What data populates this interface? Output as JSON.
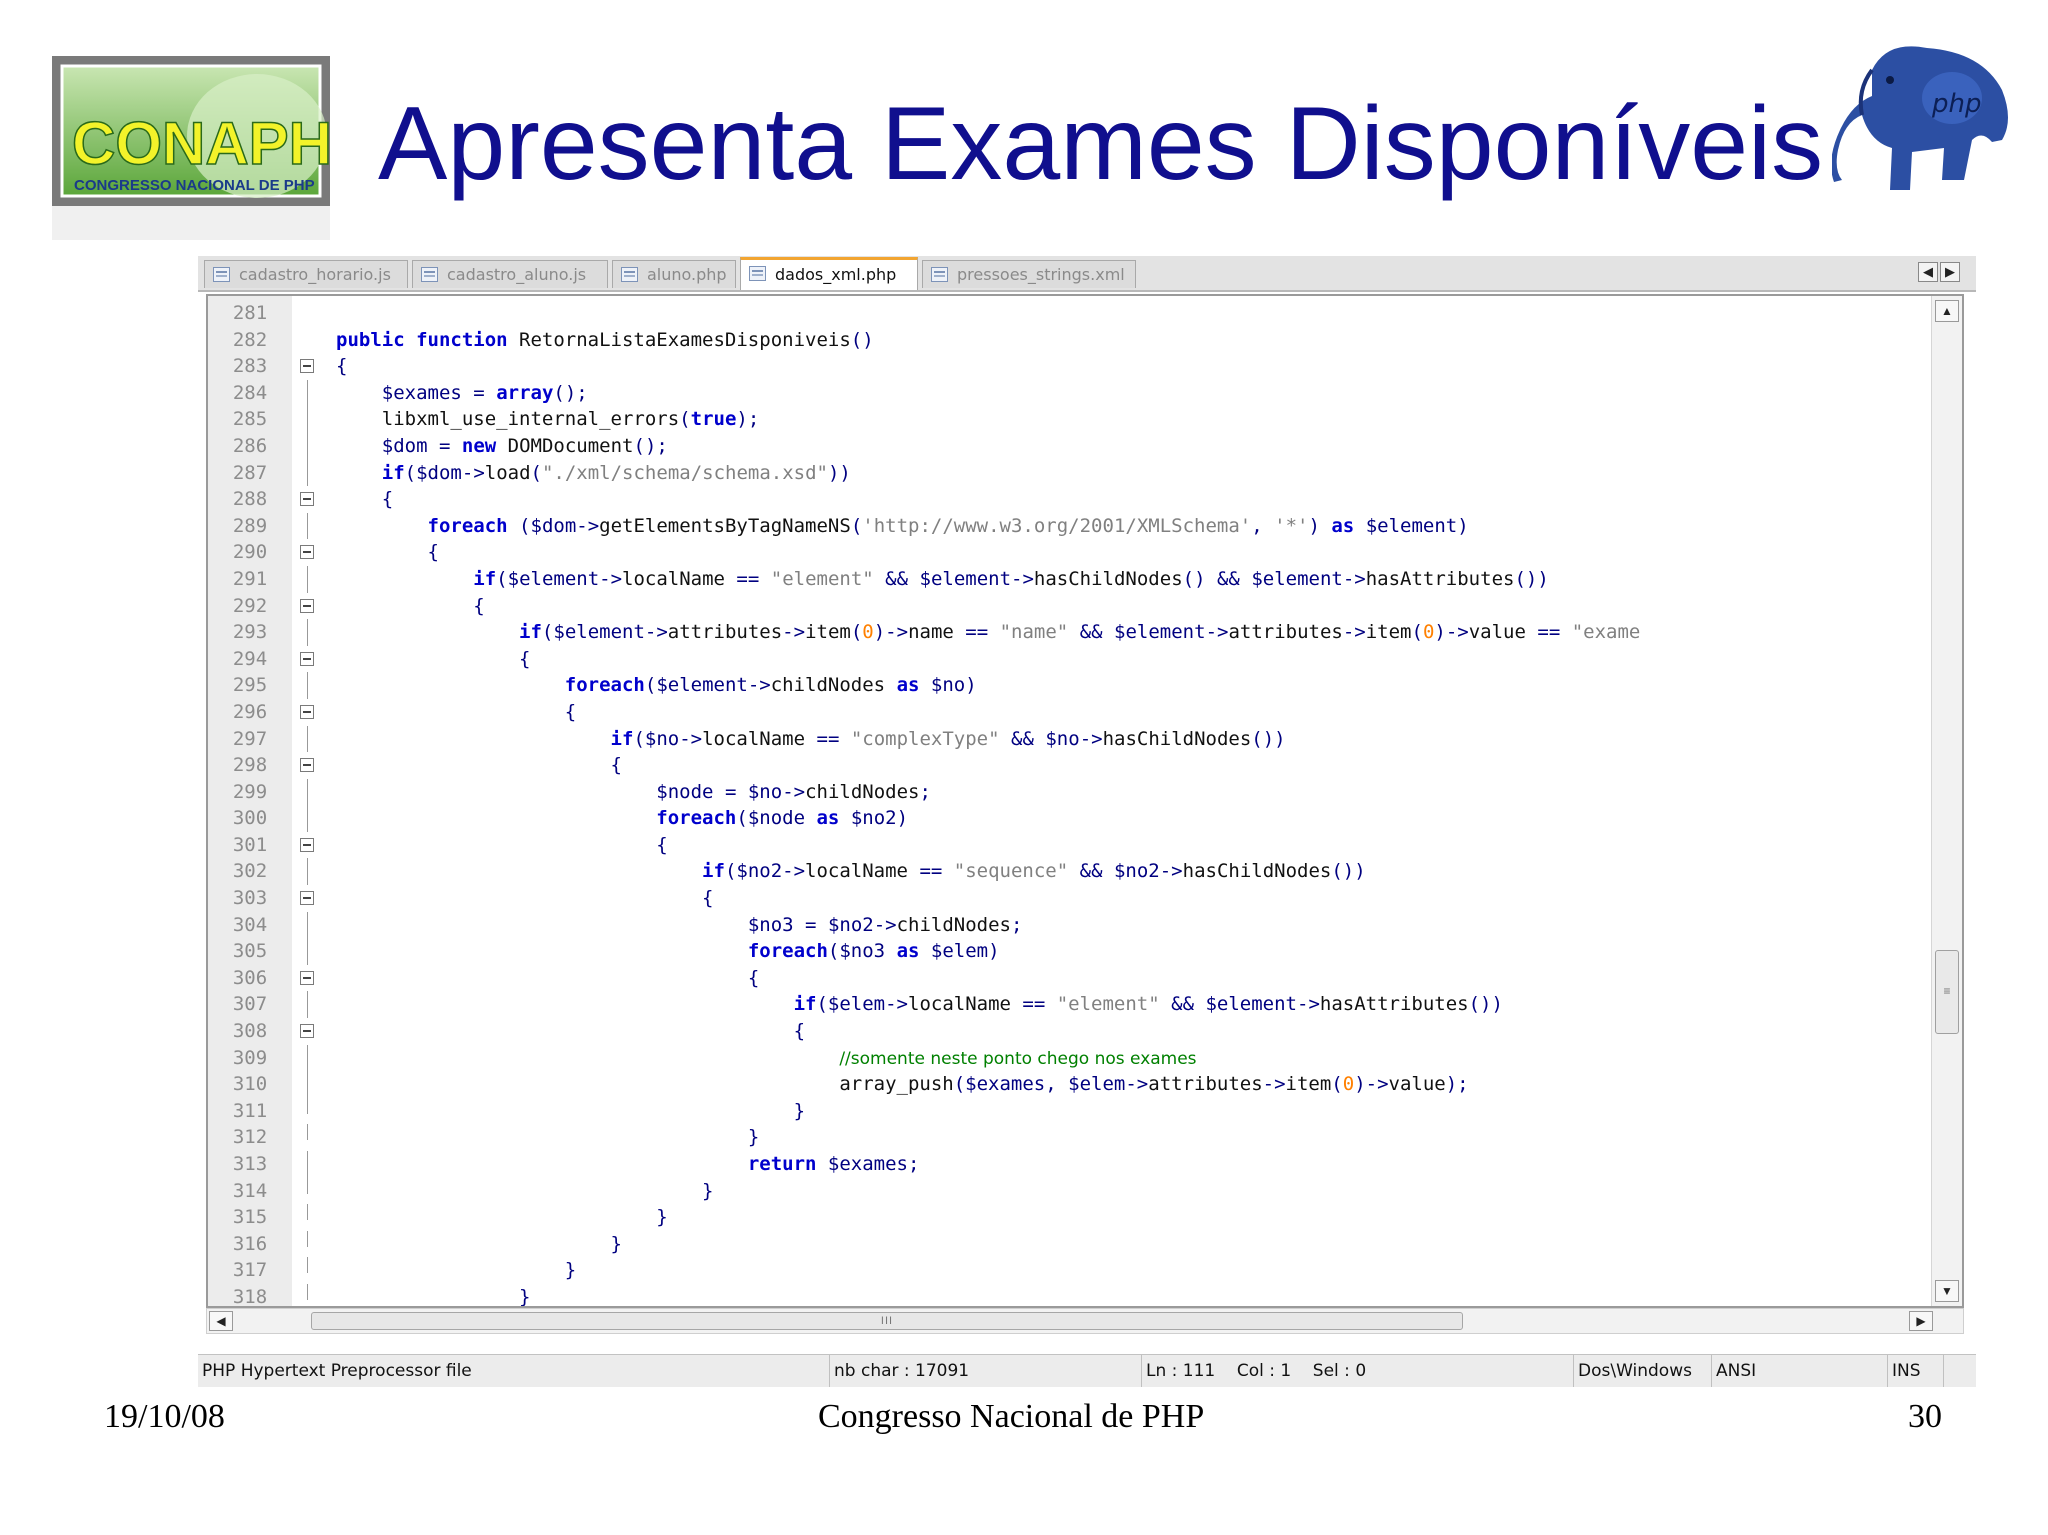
{
  "slide": {
    "title": "Apresenta Exames Disponíveis",
    "logo_text_main": "CONAPHP",
    "logo_text_sub": "CONGRESSO NACIONAL DE PHP",
    "mascot_text": "php"
  },
  "editor": {
    "tabs": [
      {
        "label": "cadastro_horario.js",
        "active": false
      },
      {
        "label": "cadastro_aluno.js",
        "active": false
      },
      {
        "label": "aluno.php",
        "active": false
      },
      {
        "label": "dados_xml.php",
        "active": true
      },
      {
        "label": "pressoes_strings.xml",
        "active": false
      }
    ],
    "lines": [
      {
        "n": "281",
        "fold": "none",
        "html": ""
      },
      {
        "n": "282",
        "fold": "none",
        "html": "<span class=\"kw\">public function</span> RetornaListaExamesDisponiveis<span class=\"op\">()</span>"
      },
      {
        "n": "283",
        "fold": "box",
        "html": "<span class=\"op\">{</span>"
      },
      {
        "n": "284",
        "fold": "line",
        "html": "    <span class=\"var\">$exames</span> <span class=\"op\">=</span> <span class=\"kw\">array</span><span class=\"op\">();</span>"
      },
      {
        "n": "285",
        "fold": "line",
        "html": "    libxml_use_internal_errors<span class=\"op\">(</span><span class=\"kw\">true</span><span class=\"op\">);</span>"
      },
      {
        "n": "286",
        "fold": "line",
        "html": "    <span class=\"var\">$dom</span> <span class=\"op\">=</span> <span class=\"kw\">new</span> DOMDocument<span class=\"op\">();</span>"
      },
      {
        "n": "287",
        "fold": "line",
        "html": "    <span class=\"kw\">if</span><span class=\"op\">(</span><span class=\"var\">$dom</span><span class=\"op\">-&gt;</span>load<span class=\"op\">(</span><span class=\"str\">\"./xml/schema/schema.xsd\"</span><span class=\"op\">))</span>"
      },
      {
        "n": "288",
        "fold": "box",
        "html": "    <span class=\"op\">{</span>"
      },
      {
        "n": "289",
        "fold": "line",
        "html": "        <span class=\"kw\">foreach</span> <span class=\"op\">(</span><span class=\"var\">$dom</span><span class=\"op\">-&gt;</span>getElementsByTagNameNS<span class=\"op\">(</span><span class=\"str\">'http://www.w3.org/2001/XMLSchema'</span><span class=\"op\">,</span> <span class=\"str\">'*'</span><span class=\"op\">)</span> <span class=\"kw\">as</span> <span class=\"var\">$element</span><span class=\"op\">)</span>"
      },
      {
        "n": "290",
        "fold": "box",
        "html": "        <span class=\"op\">{</span>"
      },
      {
        "n": "291",
        "fold": "line",
        "html": "            <span class=\"kw\">if</span><span class=\"op\">(</span><span class=\"var\">$element</span><span class=\"op\">-&gt;</span>localName <span class=\"op\">==</span> <span class=\"str\">\"element\"</span> <span class=\"op\">&amp;&amp;</span> <span class=\"var\">$element</span><span class=\"op\">-&gt;</span>hasChildNodes<span class=\"op\">()</span> <span class=\"op\">&amp;&amp;</span> <span class=\"var\">$element</span><span class=\"op\">-&gt;</span>hasAttributes<span class=\"op\">())</span>"
      },
      {
        "n": "292",
        "fold": "box",
        "html": "            <span class=\"op\">{</span>"
      },
      {
        "n": "293",
        "fold": "line",
        "html": "                <span class=\"kw\">if</span><span class=\"op\">(</span><span class=\"var\">$element</span><span class=\"op\">-&gt;</span>attributes<span class=\"op\">-&gt;</span>item<span class=\"op\">(</span><span class=\"num\">0</span><span class=\"op\">)-&gt;</span>name <span class=\"op\">==</span> <span class=\"str\">\"name\"</span> <span class=\"op\">&amp;&amp;</span> <span class=\"var\">$element</span><span class=\"op\">-&gt;</span>attributes<span class=\"op\">-&gt;</span>item<span class=\"op\">(</span><span class=\"num\">0</span><span class=\"op\">)-&gt;</span>value <span class=\"op\">==</span> <span class=\"str\">\"exame</span>"
      },
      {
        "n": "294",
        "fold": "box",
        "html": "                <span class=\"op\">{</span>"
      },
      {
        "n": "295",
        "fold": "line",
        "html": "                    <span class=\"kw\">foreach</span><span class=\"op\">(</span><span class=\"var\">$element</span><span class=\"op\">-&gt;</span>childNodes <span class=\"kw\">as</span> <span class=\"var\">$no</span><span class=\"op\">)</span>"
      },
      {
        "n": "296",
        "fold": "box",
        "html": "                    <span class=\"op\">{</span>"
      },
      {
        "n": "297",
        "fold": "line",
        "html": "                        <span class=\"kw\">if</span><span class=\"op\">(</span><span class=\"var\">$no</span><span class=\"op\">-&gt;</span>localName <span class=\"op\">==</span> <span class=\"str\">\"complexType\"</span> <span class=\"op\">&amp;&amp;</span> <span class=\"var\">$no</span><span class=\"op\">-&gt;</span>hasChildNodes<span class=\"op\">())</span>"
      },
      {
        "n": "298",
        "fold": "box",
        "html": "                        <span class=\"op\">{</span>"
      },
      {
        "n": "299",
        "fold": "line",
        "html": "                            <span class=\"var\">$node</span> <span class=\"op\">=</span> <span class=\"var\">$no</span><span class=\"op\">-&gt;</span>childNodes<span class=\"op\">;</span>"
      },
      {
        "n": "300",
        "fold": "line",
        "html": "                            <span class=\"kw\">foreach</span><span class=\"op\">(</span><span class=\"var\">$node</span> <span class=\"kw\">as</span> <span class=\"var\">$no2</span><span class=\"op\">)</span>"
      },
      {
        "n": "301",
        "fold": "box",
        "html": "                            <span class=\"op\">{</span>"
      },
      {
        "n": "302",
        "fold": "line",
        "html": "                                <span class=\"kw\">if</span><span class=\"op\">(</span><span class=\"var\">$no2</span><span class=\"op\">-&gt;</span>localName <span class=\"op\">==</span> <span class=\"str\">\"sequence\"</span> <span class=\"op\">&amp;&amp;</span> <span class=\"var\">$no2</span><span class=\"op\">-&gt;</span>hasChildNodes<span class=\"op\">())</span>"
      },
      {
        "n": "303",
        "fold": "box",
        "html": "                                <span class=\"op\">{</span>"
      },
      {
        "n": "304",
        "fold": "line",
        "html": "                                    <span class=\"var\">$no3</span> <span class=\"op\">=</span> <span class=\"var\">$no2</span><span class=\"op\">-&gt;</span>childNodes<span class=\"op\">;</span>"
      },
      {
        "n": "305",
        "fold": "line",
        "html": "                                    <span class=\"kw\">foreach</span><span class=\"op\">(</span><span class=\"var\">$no3</span> <span class=\"kw\">as</span> <span class=\"var\">$elem</span><span class=\"op\">)</span>"
      },
      {
        "n": "306",
        "fold": "box",
        "html": "                                    <span class=\"op\">{</span>"
      },
      {
        "n": "307",
        "fold": "line",
        "html": "                                        <span class=\"kw\">if</span><span class=\"op\">(</span><span class=\"var\">$elem</span><span class=\"op\">-&gt;</span>localName <span class=\"op\">==</span> <span class=\"str\">\"element\"</span> <span class=\"op\">&amp;&amp;</span> <span class=\"var\">$element</span><span class=\"op\">-&gt;</span>hasAttributes<span class=\"op\">())</span>"
      },
      {
        "n": "308",
        "fold": "box",
        "html": "                                        <span class=\"op\">{</span>"
      },
      {
        "n": "309",
        "fold": "line",
        "html": "                                            <span class=\"cmt\">//somente neste ponto chego nos exames</span>"
      },
      {
        "n": "310",
        "fold": "line",
        "html": "                                            array_push<span class=\"op\">(</span><span class=\"var\">$exames</span><span class=\"op\">,</span> <span class=\"var\">$elem</span><span class=\"op\">-&gt;</span>attributes<span class=\"op\">-&gt;</span>item<span class=\"op\">(</span><span class=\"num\">0</span><span class=\"op\">)-&gt;</span>value<span class=\"op\">);</span>"
      },
      {
        "n": "311",
        "fold": "end",
        "html": "                                        <span class=\"op\">}</span>"
      },
      {
        "n": "312",
        "fold": "end",
        "html": "                                    <span class=\"op\">}</span>"
      },
      {
        "n": "313",
        "fold": "line",
        "html": "                                    <span class=\"kw\">return</span> <span class=\"var\">$exames</span><span class=\"op\">;</span>"
      },
      {
        "n": "314",
        "fold": "end",
        "html": "                                <span class=\"op\">}</span>"
      },
      {
        "n": "315",
        "fold": "end",
        "html": "                            <span class=\"op\">}</span>"
      },
      {
        "n": "316",
        "fold": "end",
        "html": "                        <span class=\"op\">}</span>"
      },
      {
        "n": "317",
        "fold": "end",
        "html": "                    <span class=\"op\">}</span>"
      },
      {
        "n": "318",
        "fold": "end",
        "html": "                <span class=\"op\">}</span>"
      }
    ],
    "hscroll_grip": "III",
    "vscroll_grip": "≡",
    "status": {
      "file_type": "PHP Hypertext Preprocessor file",
      "nb_char": "nb char : 17091",
      "position": "Ln : 111    Col : 1    Sel : 0",
      "eol": "Dos\\Windows",
      "encoding": "ANSI",
      "mode": "INS"
    }
  },
  "footer": {
    "date": "19/10/08",
    "center": "Congresso Nacional de PHP",
    "page": "30"
  },
  "colors": {
    "title": "#100f8e",
    "keyword": "#0000cc",
    "string": "#808080",
    "number": "#ff8000",
    "comment": "#008000",
    "active_tab_accent": "#f2a531"
  }
}
